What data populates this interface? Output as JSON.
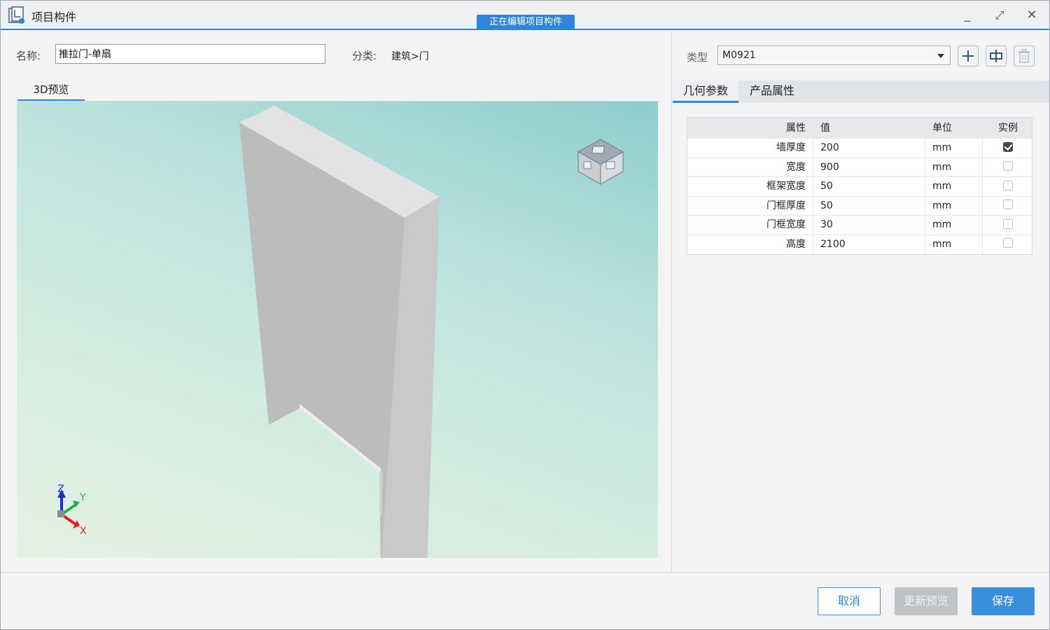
{
  "window": {
    "title": "项目构件",
    "edit_badge": "正在编辑项目构件",
    "controls": {
      "minimize": "_",
      "maximize": "⤢",
      "close": "✕"
    }
  },
  "form": {
    "name_label": "名称:",
    "name_value": "推拉门-单扇",
    "category_label": "分类:",
    "category_value": "建筑>门"
  },
  "preview": {
    "tab_label": "3D预览",
    "axes": {
      "z": "Z",
      "y": "Y",
      "x": "X"
    }
  },
  "type_panel": {
    "label": "类型",
    "selected": "M0921",
    "tools": [
      "plus-icon",
      "insert-icon",
      "trash-icon"
    ]
  },
  "prop_tabs": [
    {
      "label": "几何参数",
      "active": true
    },
    {
      "label": "产品属性",
      "active": false
    }
  ],
  "prop_table": {
    "headers": {
      "attr": "属性",
      "value": "值",
      "unit": "单位",
      "instance": "实例"
    },
    "rows": [
      {
        "attr": "墙厚度",
        "value": "200",
        "unit": "mm",
        "instance": true
      },
      {
        "attr": "宽度",
        "value": "900",
        "unit": "mm",
        "instance": false
      },
      {
        "attr": "框架宽度",
        "value": "50",
        "unit": "mm",
        "instance": false
      },
      {
        "attr": "门框厚度",
        "value": "50",
        "unit": "mm",
        "instance": false
      },
      {
        "attr": "门框宽度",
        "value": "30",
        "unit": "mm",
        "instance": false
      },
      {
        "attr": "高度",
        "value": "2100",
        "unit": "mm",
        "instance": false
      }
    ]
  },
  "footer": {
    "cancel_label": "取消",
    "refresh_label": "更新预览",
    "save_label": "保存"
  },
  "colors": {
    "accent": "#2f86d8",
    "viewport_top": "#8dcdcd",
    "viewport_bottom": "#e4f2e4",
    "wall_front": "#bdbdbd",
    "wall_top": "#e2e2e2"
  }
}
